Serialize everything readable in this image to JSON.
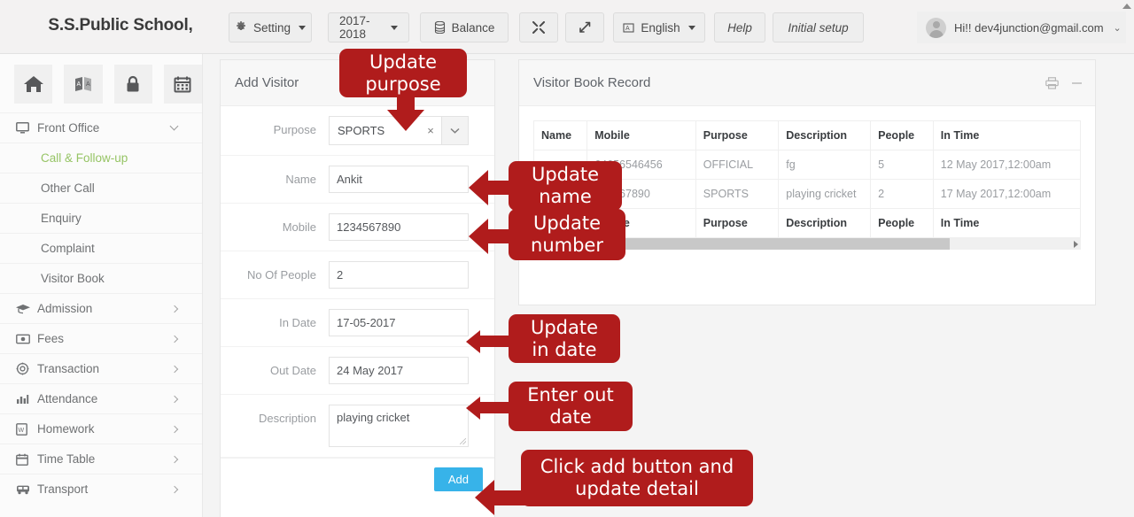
{
  "header": {
    "brand": "S.S.Public School,",
    "buttons": [
      {
        "id": "setting",
        "label": "Setting",
        "icon": "gear-icon",
        "caret": true
      },
      {
        "id": "session",
        "label": "2017-2018",
        "icon": null,
        "caret": true
      },
      {
        "id": "balance",
        "label": "Balance",
        "icon": "database-icon",
        "caret": false
      },
      {
        "id": "expand",
        "label": "",
        "icon": "expand-arrows-icon",
        "caret": false
      },
      {
        "id": "resize",
        "label": "",
        "icon": "diagonal-arrows-icon",
        "caret": false
      },
      {
        "id": "language",
        "label": "English",
        "icon": "flag-icon",
        "caret": true
      },
      {
        "id": "help",
        "label": "Help",
        "icon": null,
        "caret": false
      },
      {
        "id": "initial_setup",
        "label": "Initial setup",
        "icon": null,
        "caret": false
      }
    ],
    "user": {
      "greeting": "Hi!! dev4junction@gmail.com"
    }
  },
  "sidebar": {
    "quick_icons": [
      "home-icon",
      "translate-icon",
      "lock-icon",
      "calendar-icon"
    ],
    "items": [
      {
        "label": "Front Office",
        "icon": "monitor-icon",
        "arrow": "down",
        "type": "group"
      },
      {
        "label": "Call & Follow-up",
        "icon": null,
        "arrow": null,
        "type": "sub",
        "active": true
      },
      {
        "label": "Other Call",
        "icon": null,
        "arrow": null,
        "type": "sub",
        "active": false
      },
      {
        "label": "Enquiry",
        "icon": null,
        "arrow": null,
        "type": "sub",
        "active": false
      },
      {
        "label": "Complaint",
        "icon": null,
        "arrow": null,
        "type": "sub",
        "active": false
      },
      {
        "label": "Visitor Book",
        "icon": null,
        "arrow": null,
        "type": "sub",
        "active": false
      },
      {
        "label": "Admission",
        "icon": "graduation-cap-icon",
        "arrow": "right",
        "type": "group"
      },
      {
        "label": "Fees",
        "icon": "money-icon",
        "arrow": "right",
        "type": "group"
      },
      {
        "label": "Transaction",
        "icon": "gear-icon",
        "arrow": "right",
        "type": "group"
      },
      {
        "label": "Attendance",
        "icon": "bar-chart-icon",
        "arrow": "right",
        "type": "group"
      },
      {
        "label": "Homework",
        "icon": "document-icon",
        "arrow": "right",
        "type": "group"
      },
      {
        "label": "Time Table",
        "icon": "calendar-icon",
        "arrow": "right",
        "type": "group"
      },
      {
        "label": "Transport",
        "icon": "bus-icon",
        "arrow": "right",
        "type": "group"
      }
    ]
  },
  "add_visitor": {
    "title": "Add Visitor",
    "fields": {
      "purpose": {
        "label": "Purpose",
        "value": "SPORTS",
        "clear": "×"
      },
      "name": {
        "label": "Name",
        "value": "Ankit"
      },
      "mobile": {
        "label": "Mobile",
        "value": "1234567890"
      },
      "people": {
        "label": "No Of People",
        "value": "2"
      },
      "in_date": {
        "label": "In Date",
        "value": "17-05-2017"
      },
      "out_date": {
        "label": "Out Date",
        "value": "24 May 2017"
      },
      "description": {
        "label": "Description",
        "value": "playing cricket"
      }
    },
    "submit_label": "Add"
  },
  "record_panel": {
    "title": "Visitor Book Record",
    "tools": [
      "print-icon",
      "minimize-icon"
    ],
    "columns": [
      "Name",
      "Mobile",
      "Purpose",
      "Description",
      "People",
      "In Time"
    ],
    "rows": [
      {
        "name": "",
        "mobile": "64656546456",
        "purpose": "OFFICIAL",
        "description": "fg",
        "people": "5",
        "in_time": "12 May 2017,12:00am"
      },
      {
        "name": "",
        "mobile": "234567890",
        "purpose": "SPORTS",
        "description": "playing cricket",
        "people": "2",
        "in_time": "17 May 2017,12:00am"
      }
    ],
    "footer_columns": [
      "Name",
      "Mobile",
      "Purpose",
      "Description",
      "People",
      "In Time"
    ]
  },
  "callouts": [
    {
      "id": "purpose",
      "text": "Update purpose"
    },
    {
      "id": "name",
      "text": "Update name"
    },
    {
      "id": "number",
      "text": "Update number"
    },
    {
      "id": "in_date",
      "text": "Update in date"
    },
    {
      "id": "out_date",
      "text": "Enter out date"
    },
    {
      "id": "add",
      "text": "Click add button and update detail"
    }
  ],
  "colors": {
    "callout_red": "#b01c1c",
    "add_button_blue": "#37b3e9",
    "active_nav_green": "#96c465"
  }
}
